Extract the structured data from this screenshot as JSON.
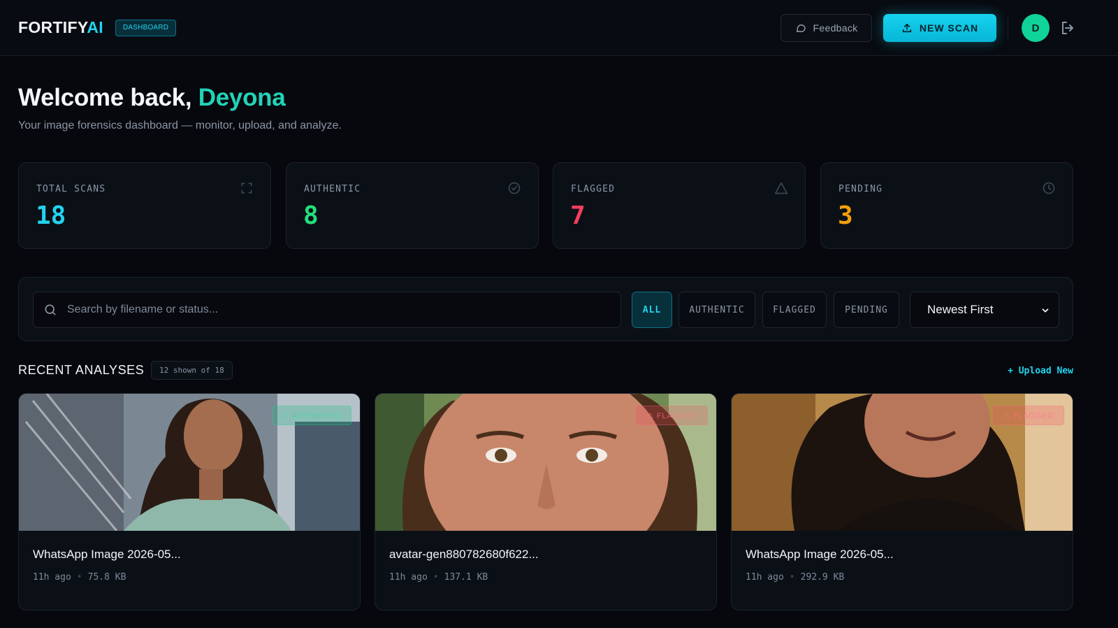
{
  "header": {
    "brand_main": "FORTIFY",
    "brand_accent": "AI",
    "badge": "DASHBOARD",
    "feedback_label": "Feedback",
    "new_scan_label": "NEW SCAN",
    "avatar_initial": "D"
  },
  "welcome": {
    "prefix": "Welcome back, ",
    "name": "Deyona",
    "subtitle": "Your image forensics dashboard — monitor, upload, and analyze."
  },
  "stats": [
    {
      "label": "TOTAL SCANS",
      "value": "18",
      "color": "#22d3ee",
      "icon": "scan-frame-icon"
    },
    {
      "label": "AUTHENTIC",
      "value": "8",
      "color": "#22e07a",
      "icon": "check-circle-icon"
    },
    {
      "label": "FLAGGED",
      "value": "7",
      "color": "#f43f5e",
      "icon": "warning-triangle-icon"
    },
    {
      "label": "PENDING",
      "value": "3",
      "color": "#f59e0b",
      "icon": "clock-icon"
    }
  ],
  "filters": {
    "search_placeholder": "Search by filename or status...",
    "buttons": [
      "ALL",
      "AUTHENTIC",
      "FLAGGED",
      "PENDING"
    ],
    "active": "ALL",
    "sort_value": "Newest First"
  },
  "recent": {
    "title": "RECENT ANALYSES",
    "count_badge": "12 shown of 18",
    "upload_new": "+ Upload New",
    "items": [
      {
        "filename": "WhatsApp Image 2026-05...",
        "age": "11h ago",
        "size": "75.8 KB",
        "status": "✓ AUTHENTIC"
      },
      {
        "filename": "avatar-gen880782680f622...",
        "age": "11h ago",
        "size": "137.1 KB",
        "status": "⚠ FLAGGED"
      },
      {
        "filename": "WhatsApp Image 2026-05...",
        "age": "11h ago",
        "size": "292.9 KB",
        "status": "⚠ FLAGGED"
      }
    ]
  },
  "colors": {
    "accent": "#22d3ee",
    "authentic": "#22e07a",
    "flagged": "#f43f5e",
    "pending": "#f59e0b"
  }
}
